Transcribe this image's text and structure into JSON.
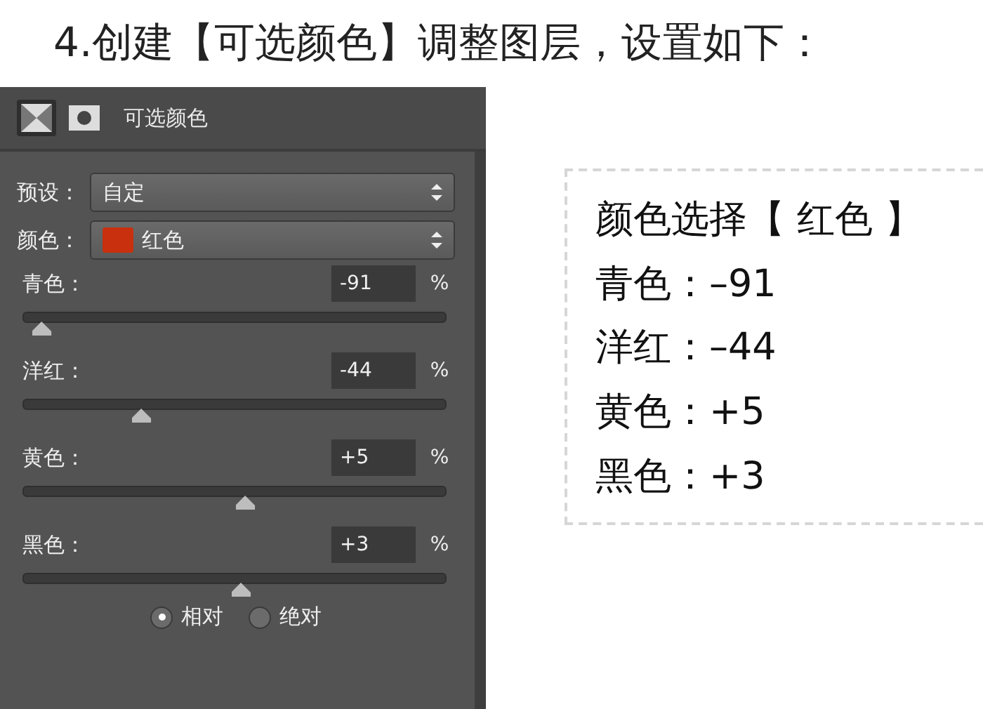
{
  "heading": "4.创建【可选颜色】调整图层，设置如下：",
  "panel": {
    "title": "可选颜色",
    "modes": [
      {
        "kind": "pixel",
        "selected": true
      },
      {
        "kind": "mask",
        "selected": false
      }
    ],
    "fields": [
      {
        "label": "预设：",
        "value": "自定"
      },
      {
        "label": "颜色：",
        "value": "红色",
        "color": "#c8300e"
      }
    ],
    "sliders": [
      {
        "label": "青色：",
        "value": "-91",
        "unit": "%",
        "level": 0.045
      },
      {
        "label": "洋红：",
        "value": "-44",
        "unit": "%",
        "level": 0.28
      },
      {
        "label": "黄色：",
        "value": "+5",
        "unit": "%",
        "level": 0.525
      },
      {
        "label": "黑色：",
        "value": "+3",
        "unit": "%",
        "level": 0.515
      }
    ],
    "methods": [
      {
        "label": "相对",
        "selected": true
      },
      {
        "label": "绝对",
        "selected": false
      }
    ]
  },
  "notes": {
    "title": "颜色选择【 红色 】",
    "lines": [
      "青色：–91",
      "洋红：–44",
      "黄色：+5",
      "黑色：+3"
    ]
  }
}
